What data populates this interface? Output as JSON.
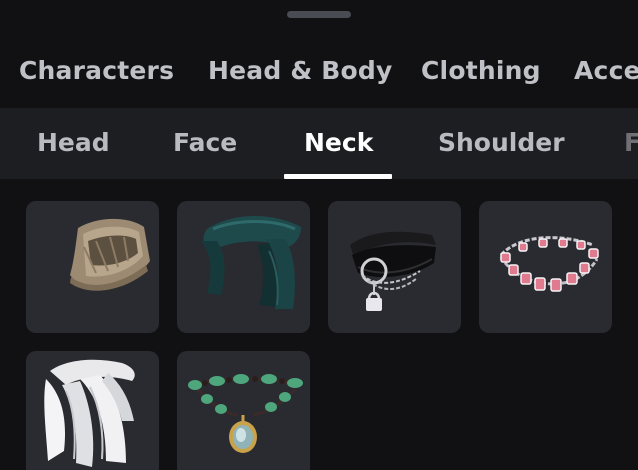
{
  "main_tabs": [
    "Characters",
    "Head & Body",
    "Clothing",
    "Acce"
  ],
  "sub_tabs": [
    "Head",
    "Face",
    "Neck",
    "Shoulder",
    "F"
  ],
  "selected_sub_tab": "Neck",
  "items": [
    {
      "icon": "tan-knit-cowl-icon"
    },
    {
      "icon": "dark-teal-scarf-icon"
    },
    {
      "icon": "black-choker-with-padlock-icon"
    },
    {
      "icon": "pink-gem-necklace-icon"
    },
    {
      "icon": "white-draped-scarf-icon"
    },
    {
      "icon": "jade-bead-pendant-necklace-icon"
    }
  ],
  "colors": {
    "background": "#111114",
    "subbar": "#1d1e22",
    "tile": "#2a2b31",
    "active": "#ffffff",
    "inactive": "#bfc1c6"
  }
}
